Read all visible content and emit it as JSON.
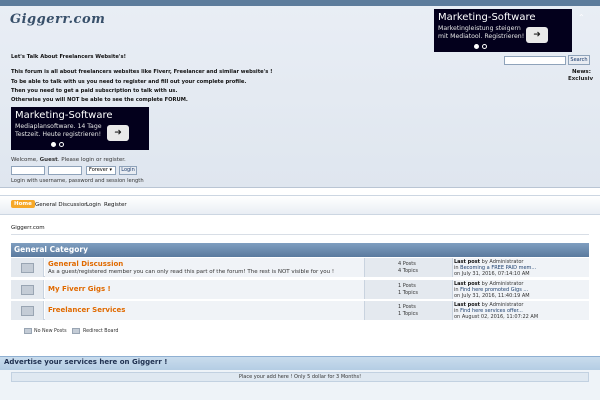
{
  "site": {
    "logo": "Giggerr.com"
  },
  "intro": {
    "heading": "Let's Talk About Freelancers Website's!",
    "line1": "This forum is all about freelancers websites like Fiverr, Freelancer and similar website's !",
    "line2": "To be able to talk with us you need to register and fill out your complete profile.",
    "line3": "Then you need to get a paid subscription to talk with us.",
    "line4": "Otherwise you will NOT be able to see the complete FORUM."
  },
  "ad_top": {
    "title": "Marketing-Software",
    "text1": "Marketingleistung steigern",
    "text2": "mit Mediatool. Registrieren!"
  },
  "ad_left": {
    "title": "Marketing-Software",
    "text1": "Mediaplansoftware. 14 Tage",
    "text2": "Testzeit. Heute registrieren!"
  },
  "search": {
    "button": "Search",
    "value": ""
  },
  "news": {
    "label": "News:",
    "text": "Exclusiv"
  },
  "login": {
    "welcome_prefix": "Welcome, ",
    "guest": "Guest",
    "welcome_suffix": ". Please login or register.",
    "session": "Forever",
    "button": "Login",
    "note": "Login with username, password and session length"
  },
  "menu": {
    "home": "Home",
    "general": "General Discussion",
    "login": "Login",
    "register": "Register"
  },
  "breadcrumb": "Giggerr.com",
  "category": {
    "title": "General Category",
    "boards": [
      {
        "name": "General Discussion",
        "desc": "As a guest/registered member you can only read this part of the forum! The rest is NOT visible for you !",
        "posts": "4 Posts",
        "topics": "4 Topics",
        "lp_label": "Last post",
        "lp_by": " by Administrator",
        "lp_in": "in ",
        "lp_topic": "Becoming a FREE PAID mem...",
        "lp_on": "on July 31, 2016, 07:14:10 AM"
      },
      {
        "name": "My Fiverr Gigs !",
        "desc": "",
        "posts": "1 Posts",
        "topics": "1 Topics",
        "lp_label": "Last post",
        "lp_by": " by Administrator",
        "lp_in": "in ",
        "lp_topic": "Find here promoted Gigs ...",
        "lp_on": "on July 31, 2016, 11:40:19 AM"
      },
      {
        "name": "Freelancer Services",
        "desc": "",
        "posts": "1 Posts",
        "topics": "1 Topics",
        "lp_label": "Last post",
        "lp_by": " by Administrator",
        "lp_in": "in ",
        "lp_topic": "Find here services offer...",
        "lp_on": "on August 02, 2016, 11:07:22 AM"
      }
    ]
  },
  "legend": {
    "new": "No New Posts",
    "redirect": "Redirect Board"
  },
  "advertise": {
    "title": "Advertise your services here on Giggerr !",
    "text": "Place your add here ! Only 5 dollar for 3 Months!"
  }
}
